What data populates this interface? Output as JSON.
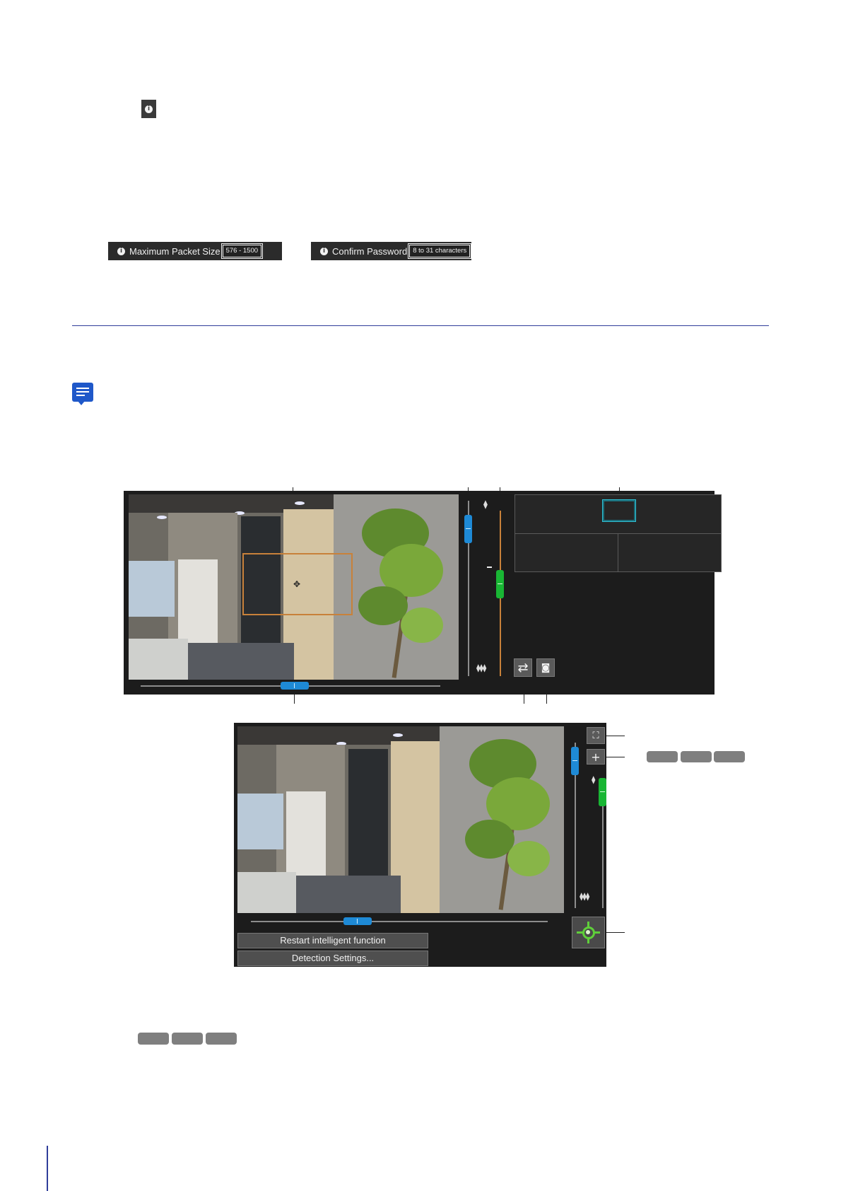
{
  "tooltips": [
    {
      "label": "Maximum Packet Size",
      "range": "576 - 1500"
    },
    {
      "label": "Confirm Password",
      "range": "8 to 31 characters"
    }
  ],
  "icons": {
    "info": "info-icon",
    "note": "note-icon",
    "swap": "swap-arrows-icon",
    "snapshot": "camera-icon",
    "fullscreen": "fullscreen-icon",
    "zoom_add": "plus-icon",
    "target": "target-icon",
    "focus_near": "single-tree-icon",
    "focus_far": "three-trees-icon"
  },
  "viewer2": {
    "restart_button": "Restart intelligent function",
    "detection_button": "Detection Settings..."
  },
  "colors": {
    "slider_blue": "#1e8ad6",
    "slider_green": "#19b634",
    "rule_blue": "#2f3d9a",
    "roi_orange": "#c8813a",
    "ptz_cyan": "#30c1d5"
  }
}
